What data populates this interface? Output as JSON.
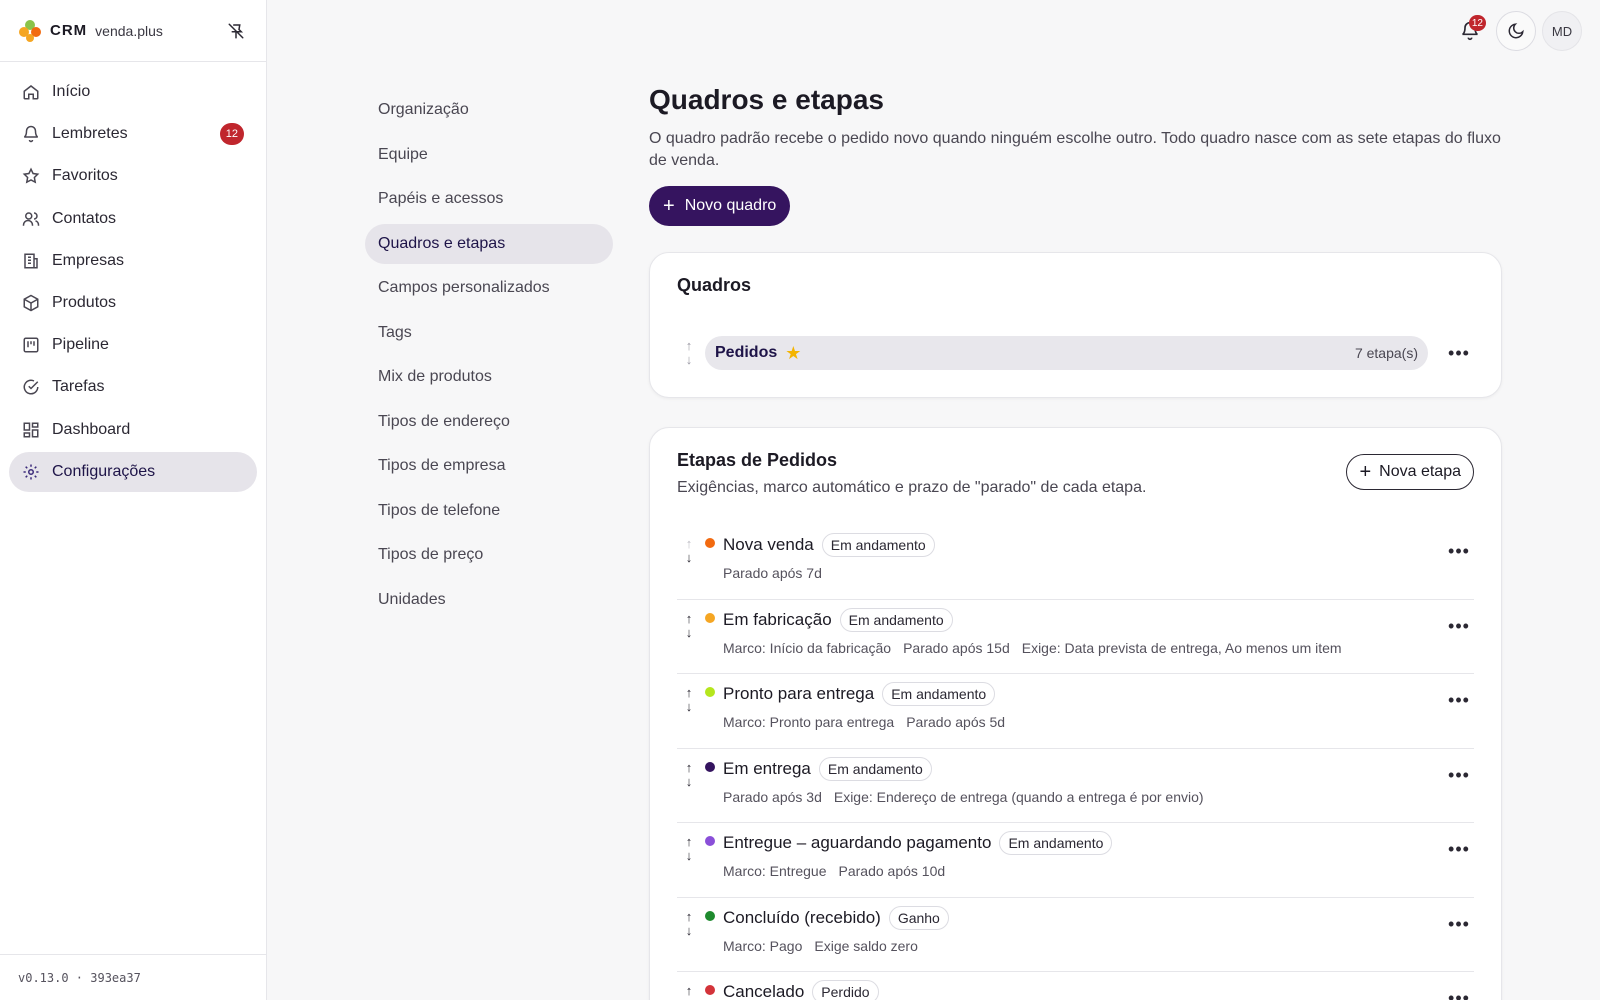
{
  "brand": {
    "name": "CRM",
    "domain": "venda.plus"
  },
  "sidebar": {
    "items": [
      {
        "label": "Início",
        "icon": "home-icon"
      },
      {
        "label": "Lembretes",
        "icon": "bell-icon",
        "badge": "12"
      },
      {
        "label": "Favoritos",
        "icon": "star-icon"
      },
      {
        "label": "Contatos",
        "icon": "users-icon"
      },
      {
        "label": "Empresas",
        "icon": "building-icon"
      },
      {
        "label": "Produtos",
        "icon": "box-icon"
      },
      {
        "label": "Pipeline",
        "icon": "kanban-icon"
      },
      {
        "label": "Tarefas",
        "icon": "check-circle-icon"
      },
      {
        "label": "Dashboard",
        "icon": "dashboard-icon"
      },
      {
        "label": "Configurações",
        "icon": "gear-icon",
        "active": true
      }
    ],
    "version": "v0.13.0 · 393ea37"
  },
  "topbar": {
    "notifications_count": "12",
    "avatar_initials": "MD"
  },
  "settings_nav": {
    "items": [
      "Organização",
      "Equipe",
      "Papéis e acessos",
      "Quadros e etapas",
      "Campos personalizados",
      "Tags",
      "Mix de produtos",
      "Tipos de endereço",
      "Tipos de empresa",
      "Tipos de telefone",
      "Tipos de preço",
      "Unidades"
    ],
    "active": "Quadros e etapas"
  },
  "main": {
    "title": "Quadros e etapas",
    "description": "O quadro padrão recebe o pedido novo quando ninguém escolhe outro. Todo quadro nasce com as sete etapas do fluxo de venda.",
    "new_board_label": "Novo quadro",
    "boards_card": {
      "title": "Quadros",
      "boards": [
        {
          "name": "Pedidos",
          "default": true,
          "count": "7 etapa(s)"
        }
      ]
    },
    "stages_card": {
      "title": "Etapas de Pedidos",
      "subtitle": "Exigências, marco automático e prazo de \"parado\" de cada etapa.",
      "new_stage_label": "Nova etapa",
      "stages": [
        {
          "name": "Nova venda",
          "status": "Em andamento",
          "color": "#f26a10",
          "meta": [
            "Parado após 7d"
          ]
        },
        {
          "name": "Em fabricação",
          "status": "Em andamento",
          "color": "#f5a623",
          "meta": [
            "Marco: Início da fabricação",
            "Parado após 15d",
            "Exige: Data prevista de entrega, Ao menos um item"
          ]
        },
        {
          "name": "Pronto para entrega",
          "status": "Em andamento",
          "color": "#b5e61d",
          "meta": [
            "Marco: Pronto para entrega",
            "Parado após 5d"
          ]
        },
        {
          "name": "Em entrega",
          "status": "Em andamento",
          "color": "#35145f",
          "meta": [
            "Parado após 3d",
            "Exige: Endereço de entrega (quando a entrega é por envio)"
          ]
        },
        {
          "name": "Entregue – aguardando pagamento",
          "status": "Em andamento",
          "color": "#8a4fd8",
          "meta": [
            "Marco: Entregue",
            "Parado após 10d"
          ]
        },
        {
          "name": "Concluído (recebido)",
          "status": "Ganho",
          "color": "#1e8a2e",
          "meta": [
            "Marco: Pago",
            "Exige saldo zero"
          ]
        },
        {
          "name": "Cancelado",
          "status": "Perdido",
          "color": "#d3333a",
          "meta": []
        }
      ]
    }
  }
}
